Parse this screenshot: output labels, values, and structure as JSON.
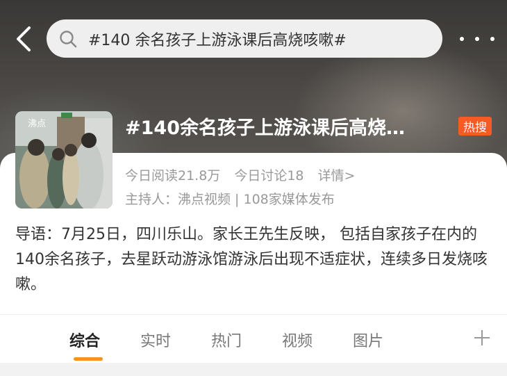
{
  "header": {
    "search_query": "#140 余名孩子上游泳课后高烧咳嗽#"
  },
  "topic": {
    "title": "#140余名孩子上游泳课后高烧…",
    "hot_badge": "热搜",
    "thumb_watermark": "沸点",
    "reads": "今日阅读21.8万",
    "discussions": "今日讨论18",
    "details_link": "详情>",
    "host": "主持人：沸点视频 | 108家媒体发布"
  },
  "intro": {
    "text": "导语：7月25日，四川乐山。家长王先生反映， 包括自家孩子在内的140余名孩子，去星跃动游泳馆游泳后出现不适症状，连续多日发烧咳嗽。"
  },
  "tabs": [
    {
      "label": "综合",
      "active": true
    },
    {
      "label": "实时",
      "active": false
    },
    {
      "label": "热门",
      "active": false
    },
    {
      "label": "视频",
      "active": false
    },
    {
      "label": "图片",
      "active": false
    }
  ],
  "colors": {
    "accent": "#f7931e",
    "badge": "#f55b22"
  },
  "icons": {
    "back": "chevron-left-icon",
    "search": "search-icon",
    "more": "more-dots-icon",
    "add": "plus-icon"
  }
}
